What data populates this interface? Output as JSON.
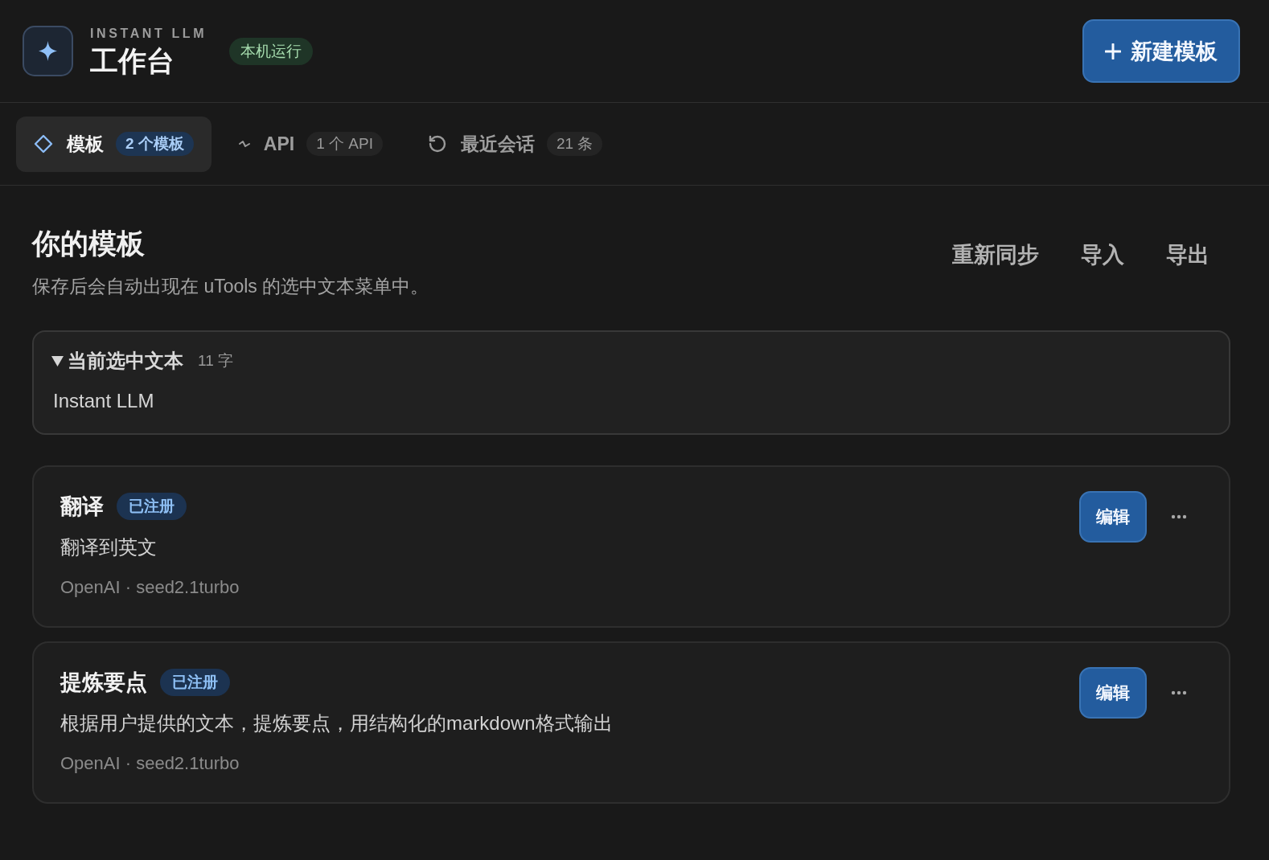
{
  "header": {
    "app_name": "INSTANT LLM",
    "title": "工作台",
    "status": "本机运行",
    "new_button": "新建模板"
  },
  "tabs": [
    {
      "kind": "templates",
      "label": "模板",
      "count": "2 个模板",
      "selected": true
    },
    {
      "kind": "api",
      "label": "API",
      "count": "1 个 API",
      "selected": false
    },
    {
      "kind": "sessions",
      "label": "最近会话",
      "count": "21 条",
      "selected": false
    }
  ],
  "section": {
    "title": "你的模板",
    "subtitle": "保存后会自动出现在 uTools 的选中文本菜单中。",
    "actions": [
      "重新同步",
      "导入",
      "导出"
    ]
  },
  "selection": {
    "title": "当前选中文本",
    "count": "11 字",
    "expanded": true,
    "text": "Instant LLM"
  },
  "templates": [
    {
      "name": "翻译",
      "badge": "已注册",
      "description": "翻译到英文",
      "meta": "OpenAI · seed2.1turbo",
      "edit": "编辑"
    },
    {
      "name": "提炼要点",
      "badge": "已注册",
      "description": "根据用户提供的文本，提炼要点，用结构化的markdown格式输出",
      "meta": "OpenAI · seed2.1turbo",
      "edit": "编辑"
    }
  ]
}
